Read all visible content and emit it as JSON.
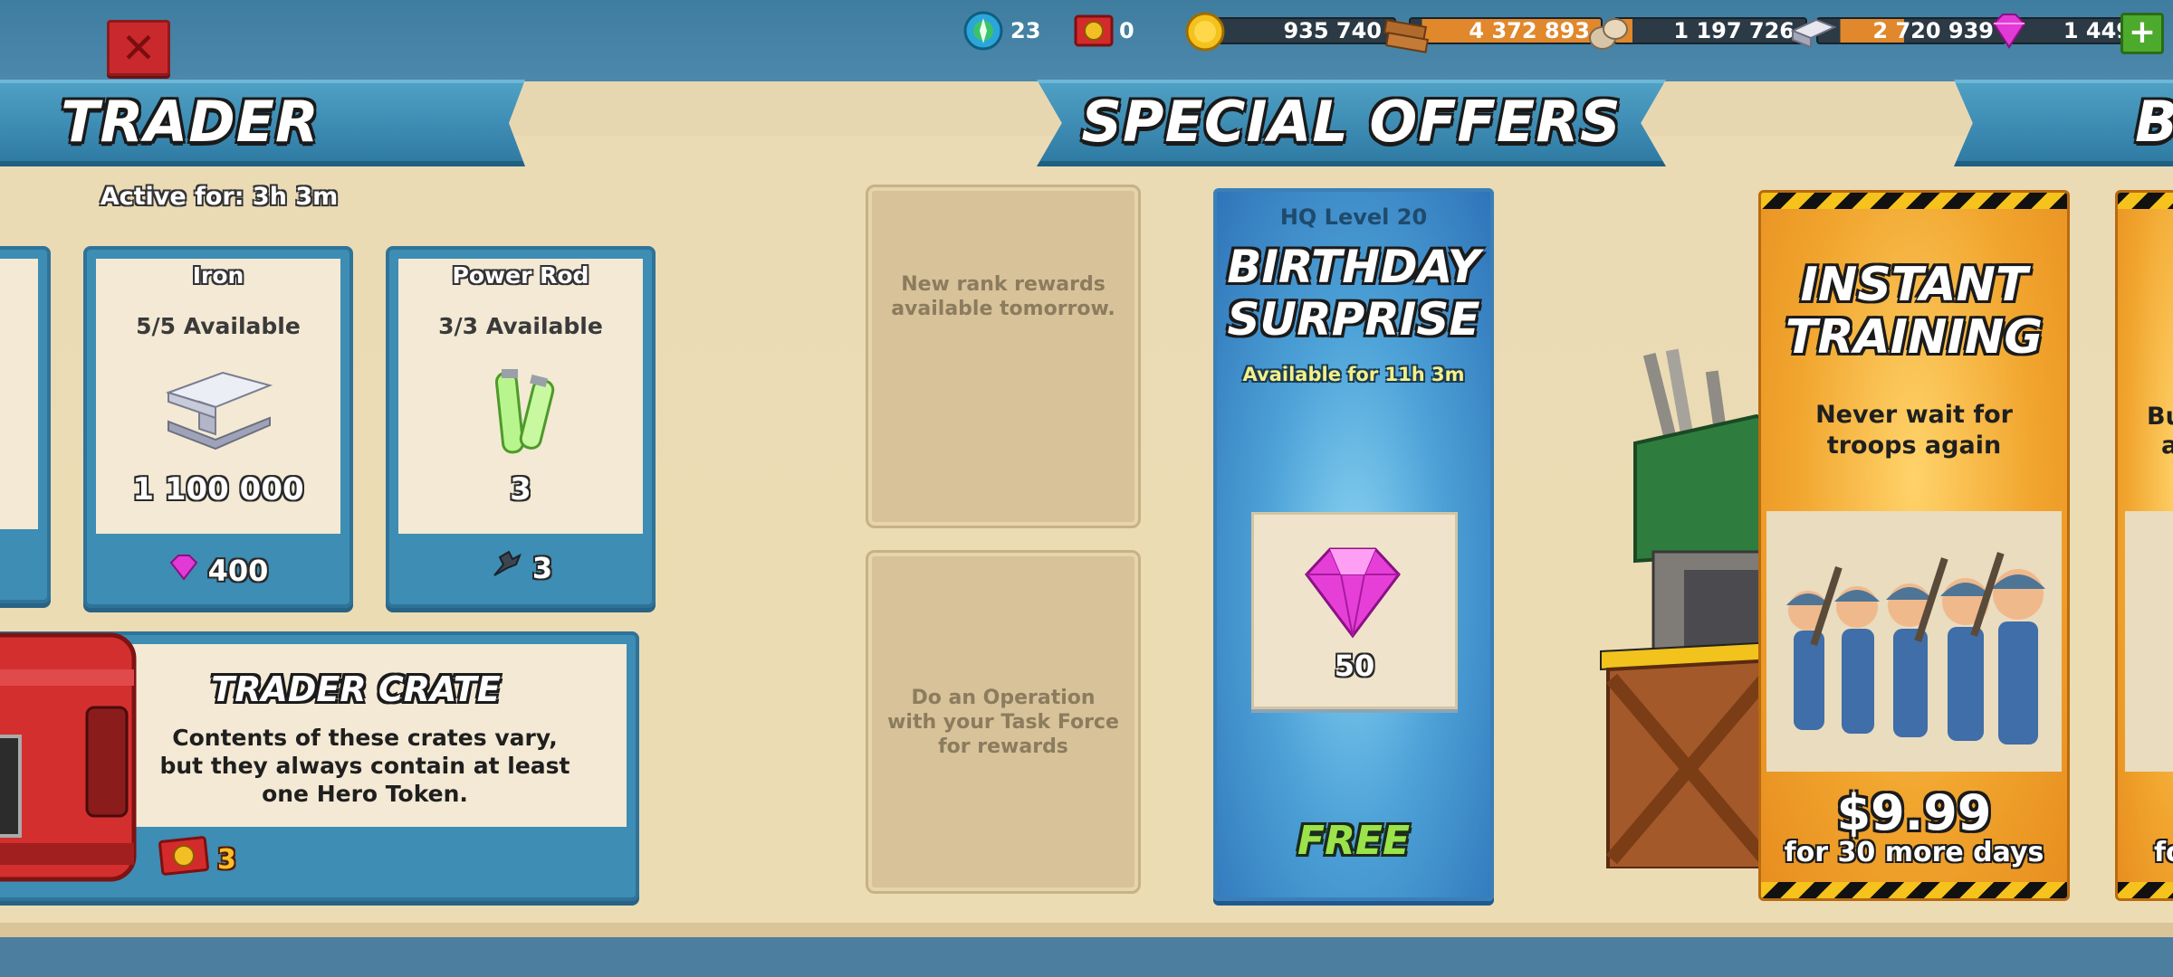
{
  "topbar": {
    "close_label": "✕",
    "resources": {
      "intel": "23",
      "hero_tokens": "0",
      "gold": "935 740",
      "wood": "4 372 893",
      "stone": "1 197 726",
      "iron": "2 720 939",
      "diamonds": "1 449",
      "add_label": "+"
    }
  },
  "banners": {
    "trader": "TRADER",
    "special_offers": "SPECIAL OFFERS",
    "next": "B"
  },
  "trader": {
    "active_for": "Active for: 3h 3m",
    "items": [
      {
        "title": "Iron",
        "availability": "5/5 Available",
        "amount": "1 100 000",
        "price": "400",
        "currency_icon": "diamond-icon"
      },
      {
        "title": "Power Rod",
        "availability": "3/3 Available",
        "amount": "3",
        "price": "3",
        "currency_icon": "power-rod-part-icon"
      }
    ],
    "crate": {
      "title": "TRADER CRATE",
      "description": "Contents of these crates vary, but they always contain at least one Hero Token.",
      "price": "3"
    }
  },
  "rank_slots": {
    "rank_text": "New rank rewards available tomorrow.",
    "operation_text": "Do an Operation with your Task Force for rewards"
  },
  "birthday_offer": {
    "requirement": "HQ Level 20",
    "title_line1": "BIRTHDAY",
    "title_line2": "SURPRISE",
    "availability": "Available for 11h 3m",
    "reward_amount": "50",
    "price_label": "FREE"
  },
  "training_offer": {
    "title_line1": "INSTANT",
    "title_line2": "TRAINING",
    "subtitle_line1": "Never wait for",
    "subtitle_line2": "troops again",
    "price": "$9.99",
    "duration": "for 30 more days"
  },
  "next_offer": {
    "text_line1": "Bu",
    "text_line2": "a",
    "duration_fragment": "fo"
  },
  "colors": {
    "banner_blue": "#3d8db4",
    "close_red": "#c9292c",
    "free_green": "#9be34a",
    "offer_orange": "#f0a531",
    "panel_tan": "#eadbb5"
  }
}
